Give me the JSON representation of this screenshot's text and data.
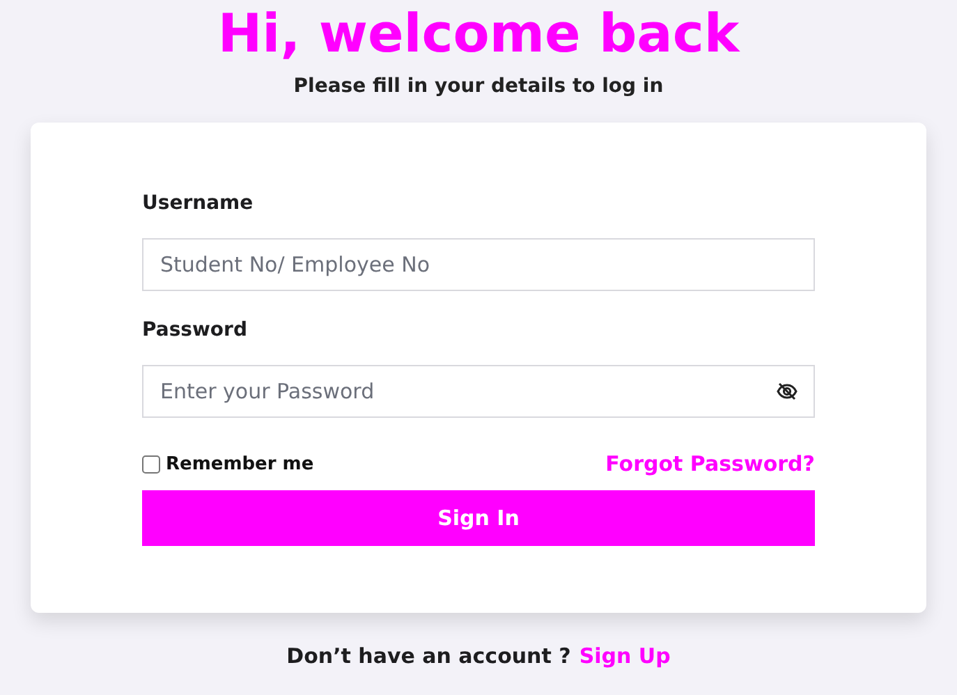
{
  "heading": "Hi, welcome back",
  "subtitle": "Please fill in your details to log in",
  "form": {
    "fields": [
      {
        "label": "Username",
        "placeholder": "Student No/ Employee No",
        "kind": "text"
      },
      {
        "label": "Password",
        "placeholder": "Enter your Password",
        "kind": "password"
      }
    ],
    "remember": {
      "label": "Remember me",
      "checked": false
    },
    "forgot": "Forgot Password?",
    "submit": "Sign In"
  },
  "footer": {
    "text": "Don’t have an account ?",
    "link": "Sign Up"
  }
}
